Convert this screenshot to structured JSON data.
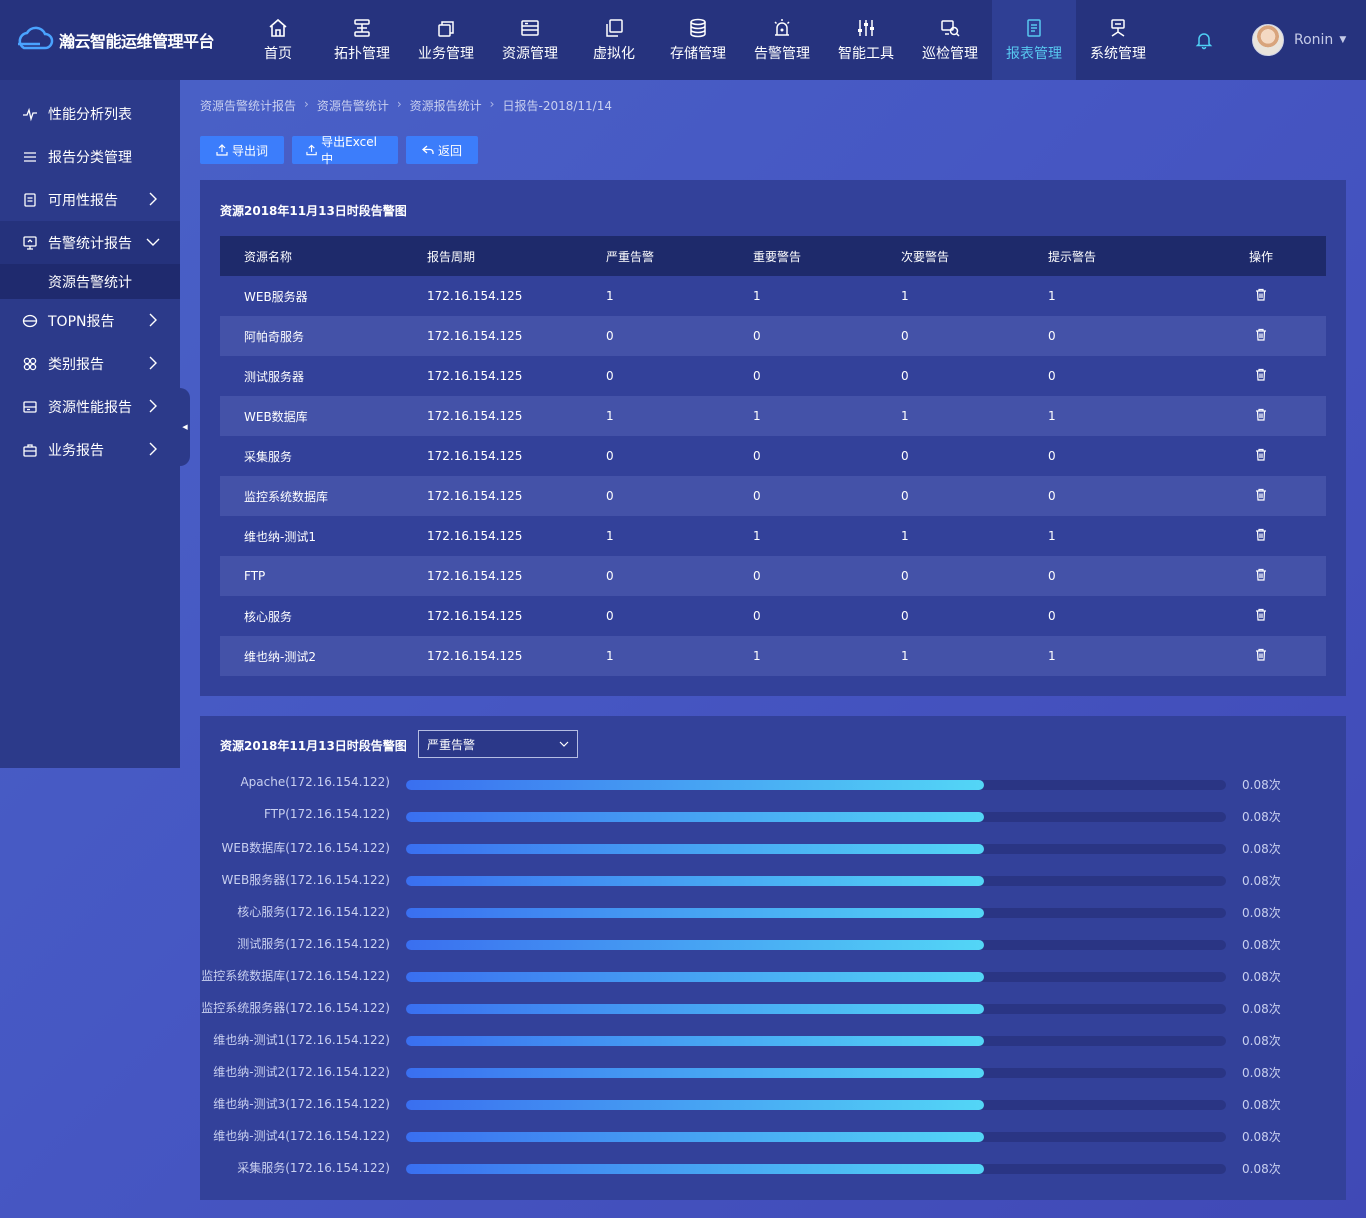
{
  "brand": {
    "title": "瀚云智能运维管理平台"
  },
  "nav": [
    {
      "label": "首页",
      "icon": "home-icon"
    },
    {
      "label": "拓扑管理",
      "icon": "topology-icon"
    },
    {
      "label": "业务管理",
      "icon": "business-icon"
    },
    {
      "label": "资源管理",
      "icon": "resource-icon"
    },
    {
      "label": "虚拟化",
      "icon": "virtual-icon"
    },
    {
      "label": "存储管理",
      "icon": "storage-icon"
    },
    {
      "label": "告警管理",
      "icon": "alarm-icon"
    },
    {
      "label": "智能工具",
      "icon": "tools-icon"
    },
    {
      "label": "巡检管理",
      "icon": "inspect-icon"
    },
    {
      "label": "报表管理",
      "icon": "report-icon",
      "active": true
    },
    {
      "label": "系统管理",
      "icon": "system-icon"
    }
  ],
  "user": {
    "name": "Ronin"
  },
  "sidebar": {
    "items": [
      {
        "label": "性能分析列表",
        "icon": "pulse-icon"
      },
      {
        "label": "报告分类管理",
        "icon": "list-icon"
      },
      {
        "label": "可用性报告",
        "icon": "document-icon",
        "arrow": "right"
      },
      {
        "label": "告警统计报告",
        "icon": "monitor-icon",
        "arrow": "down",
        "expanded": true
      },
      {
        "label": "TOPN报告",
        "icon": "topn-icon",
        "arrow": "right"
      },
      {
        "label": "类别报告",
        "icon": "category-icon",
        "arrow": "right"
      },
      {
        "label": "资源性能报告",
        "icon": "database-icon",
        "arrow": "right"
      },
      {
        "label": "业务报告",
        "icon": "briefcase-icon",
        "arrow": "right"
      }
    ],
    "sub_item": "资源告警统计"
  },
  "breadcrumb": [
    "资源告警统计报告",
    "资源告警统计",
    "资源报告统计",
    "日报告-2018/11/14"
  ],
  "buttons": {
    "export_word": "导出词",
    "export_excel": "导出Excel中",
    "back": "返回"
  },
  "table_panel": {
    "title": "资源2018年11月13日时段告警图",
    "headers": [
      "资源名称",
      "报告周期",
      "严重告警",
      "重要警告",
      "次要警告",
      "提示警告",
      "操作"
    ],
    "rows": [
      [
        "WEB服务器",
        "172.16.154.125",
        "1",
        "1",
        "1",
        "1"
      ],
      [
        "阿帕奇服务",
        "172.16.154.125",
        "0",
        "0",
        "0",
        "0"
      ],
      [
        "测试服务器",
        "172.16.154.125",
        "0",
        "0",
        "0",
        "0"
      ],
      [
        "WEB数据库",
        "172.16.154.125",
        "1",
        "1",
        "1",
        "1"
      ],
      [
        "采集服务",
        "172.16.154.125",
        "0",
        "0",
        "0",
        "0"
      ],
      [
        "监控系统数据库",
        "172.16.154.125",
        "0",
        "0",
        "0",
        "0"
      ],
      [
        "维也纳-测试1",
        "172.16.154.125",
        "1",
        "1",
        "1",
        "1"
      ],
      [
        "FTP",
        "172.16.154.125",
        "0",
        "0",
        "0",
        "0"
      ],
      [
        "核心服务",
        "172.16.154.125",
        "0",
        "0",
        "0",
        "0"
      ],
      [
        "维也纳-测试2",
        "172.16.154.125",
        "1",
        "1",
        "1",
        "1"
      ]
    ]
  },
  "bar_panel": {
    "title": "资源2018年11月13日时段告警图",
    "select_value": "严重告警",
    "bars": [
      {
        "label": "Apache(172.16.154.122)",
        "value": "0.08次",
        "fill": 0.705
      },
      {
        "label": "FTP(172.16.154.122)",
        "value": "0.08次",
        "fill": 0.705
      },
      {
        "label": "WEB数据库(172.16.154.122)",
        "value": "0.08次",
        "fill": 0.705
      },
      {
        "label": "WEB服务器(172.16.154.122)",
        "value": "0.08次",
        "fill": 0.705
      },
      {
        "label": "核心服务(172.16.154.122)",
        "value": "0.08次",
        "fill": 0.705
      },
      {
        "label": "测试服务(172.16.154.122)",
        "value": "0.08次",
        "fill": 0.705
      },
      {
        "label": "监控系统数据库(172.16.154.122)",
        "value": "0.08次",
        "fill": 0.705
      },
      {
        "label": "监控系统服务器(172.16.154.122)",
        "value": "0.08次",
        "fill": 0.705
      },
      {
        "label": "维也纳-测试1(172.16.154.122)",
        "value": "0.08次",
        "fill": 0.705
      },
      {
        "label": "维也纳-测试2(172.16.154.122)",
        "value": "0.08次",
        "fill": 0.705
      },
      {
        "label": "维也纳-测试3(172.16.154.122)",
        "value": "0.08次",
        "fill": 0.705
      },
      {
        "label": "维也纳-测试4(172.16.154.122)",
        "value": "0.08次",
        "fill": 0.705
      },
      {
        "label": "采集服务(172.16.154.122)",
        "value": "0.08次",
        "fill": 0.705
      }
    ]
  },
  "colors": {
    "accent": "#3c7dfb",
    "active_nav": "#58c8f0",
    "bar_start": "#3a6ff0",
    "bar_end": "#53d6f6"
  }
}
